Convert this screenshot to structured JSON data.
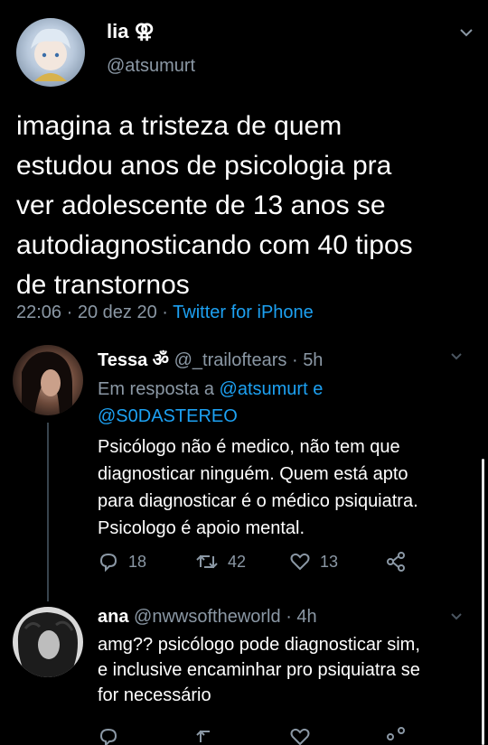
{
  "main_tweet": {
    "display_name": "lia ⚢",
    "handle": "@atsumurt",
    "text_lines": [
      "imagina a tristeza de quem",
      "estudou anos de psicologia pra",
      "ver adolescente de 13 anos se",
      "autodiagnosticando com 40 tipos",
      "de transtornos"
    ],
    "time": "22:06",
    "date": "20 dez 20",
    "source": "Twitter for iPhone",
    "separator": "·"
  },
  "reply1": {
    "display_name": "Tessa ॐ",
    "handle": "@_trailoftears",
    "age": "5h",
    "in_reply_label": "Em resposta a",
    "in_reply_user1": "@atsumurt",
    "in_reply_joiner": "e",
    "in_reply_user2": "@S0DASTEREO",
    "text_lines": [
      "Psicólogo não é medico, não tem que",
      "diagnosticar ninguém. Quem está apto",
      "para diagnosticar é o médico psiquiatra.",
      "Psicologo é apoio mental."
    ],
    "replies": "18",
    "retweets": "42",
    "likes": "13"
  },
  "reply2": {
    "display_name": "ana",
    "handle": "@nwwsoftheworld",
    "age": "4h",
    "text_lines": [
      "amg?? psicólogo pode diagnosticar sim,",
      "e inclusive encaminhar pro psiquiatra se",
      "for necessário"
    ]
  },
  "colors": {
    "background": "#000000",
    "muted": "#8b98a5",
    "link": "#1da1f2"
  }
}
